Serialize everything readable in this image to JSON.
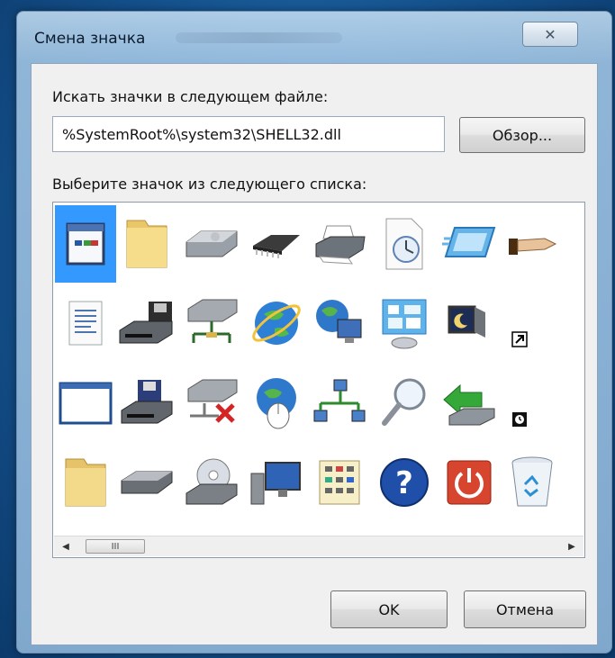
{
  "window": {
    "title": "Смена значка",
    "close_glyph": "✕"
  },
  "search_label": "Искать значки в следующем файле:",
  "file_path": "%SystemRoot%\\system32\\SHELL32.dll",
  "browse_button": "Обзор...",
  "list_label": "Выберите значок из следующего списка:",
  "icons": [
    [
      "app-window-icon",
      "folder-icon",
      "hard-drive-icon",
      "memory-chip-icon",
      "printer-icon",
      "clock-document-icon",
      "display-settings-icon",
      "sharing-hand-icon"
    ],
    [
      "text-document-icon",
      "drive-with-floppy-icon",
      "network-drive-icon",
      "internet-globe-icon",
      "globe-computer-icon",
      "control-panel-icon",
      "monitor-moon-icon",
      "shortcut-arrow-icon"
    ],
    [
      "blank-window-icon",
      "floppy-drive-icon",
      "disconnected-drive-icon",
      "globe-mouse-icon",
      "network-computers-icon",
      "magnifier-icon",
      "green-arrow-drive-icon",
      "clock-badge-icon"
    ],
    [
      "folder-open-icon",
      "optical-drive-icon",
      "cd-drive-icon",
      "computer-monitor-icon",
      "grid-list-icon",
      "help-icon",
      "power-icon",
      "recycle-bin-icon"
    ]
  ],
  "selected_icon": "app-window-icon",
  "scrollbar": {
    "thumb_glyph": "III",
    "left_arrow": "◀",
    "right_arrow": "▶"
  },
  "ok_button": "OK",
  "cancel_button": "Отмена"
}
